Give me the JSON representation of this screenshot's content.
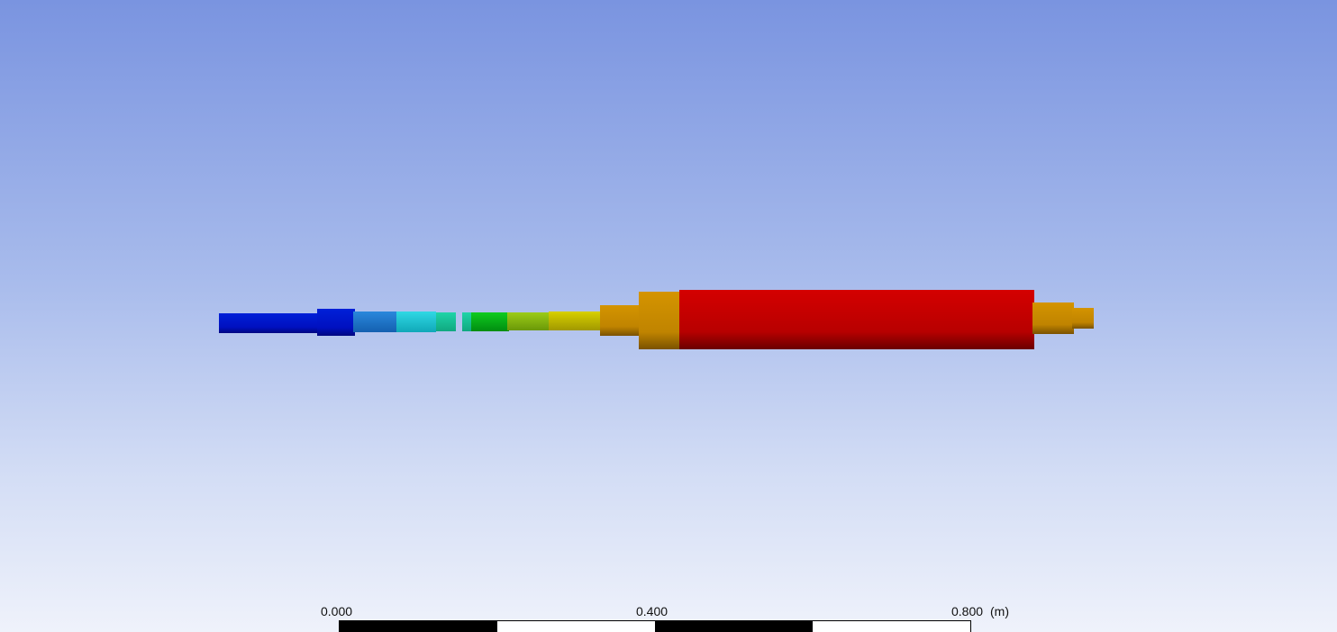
{
  "viewport": {
    "background_top": "#7a94e0",
    "background_bottom": "#eff2fb"
  },
  "model": {
    "name": "contour-shaft-assembly",
    "colors": {
      "blue": "#0018c8",
      "dark_blue": "#0008b0",
      "steel_blue": "#1e7ad0",
      "cyan": "#20c8d8",
      "teal": "#18c8a0",
      "green": "#00b818",
      "yellow_green": "#8cc010",
      "yellow": "#c8c000",
      "orange": "#c88a00",
      "red": "#c80000"
    }
  },
  "scale": {
    "ticks": [
      {
        "label": "0.000"
      },
      {
        "label": "0.400"
      },
      {
        "label": "0.800"
      }
    ],
    "unit": "(m)",
    "segments": [
      "dark",
      "light",
      "dark",
      "light"
    ]
  }
}
